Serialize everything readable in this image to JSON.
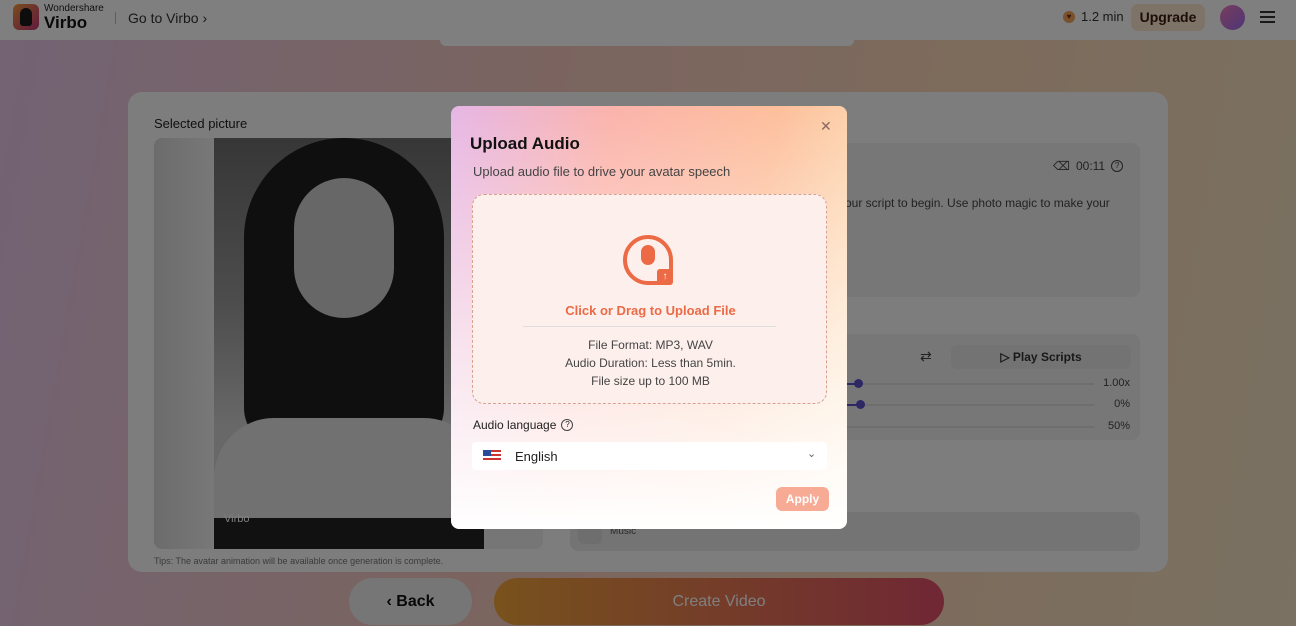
{
  "header": {
    "brand_top": "Wondershare",
    "brand": "Virbo",
    "goto": "Go to Virbo ›",
    "minutes": "1.2 min",
    "upgrade": "Upgrade"
  },
  "main": {
    "selected_picture": "Selected picture",
    "watermark": "Virbo",
    "tips": "Tips: The avatar animation will be available once generation is complete.",
    "script_text": "our script to begin. Use photo magic to make your",
    "duration": "00:11",
    "play_scripts": "Play Scripts",
    "sliders": [
      {
        "value": "1.00x",
        "level": 0.05
      },
      {
        "value": "0%",
        "level": 0.06
      },
      {
        "value": "50%",
        "level": 0
      }
    ],
    "music": "Music",
    "back": "‹ Back",
    "create_video": "Create Video"
  },
  "modal": {
    "title": "Upload Audio",
    "subtitle": "Upload audio file to drive your avatar speech",
    "drop_title": "Click or Drag to Upload File",
    "info": [
      "File Format: MP3, WAV",
      "Audio Duration: Less than 5min.",
      "File size up to 100 MB"
    ],
    "language_label": "Audio language",
    "language": "English",
    "apply": "Apply",
    "accent": "#ec6a45"
  }
}
